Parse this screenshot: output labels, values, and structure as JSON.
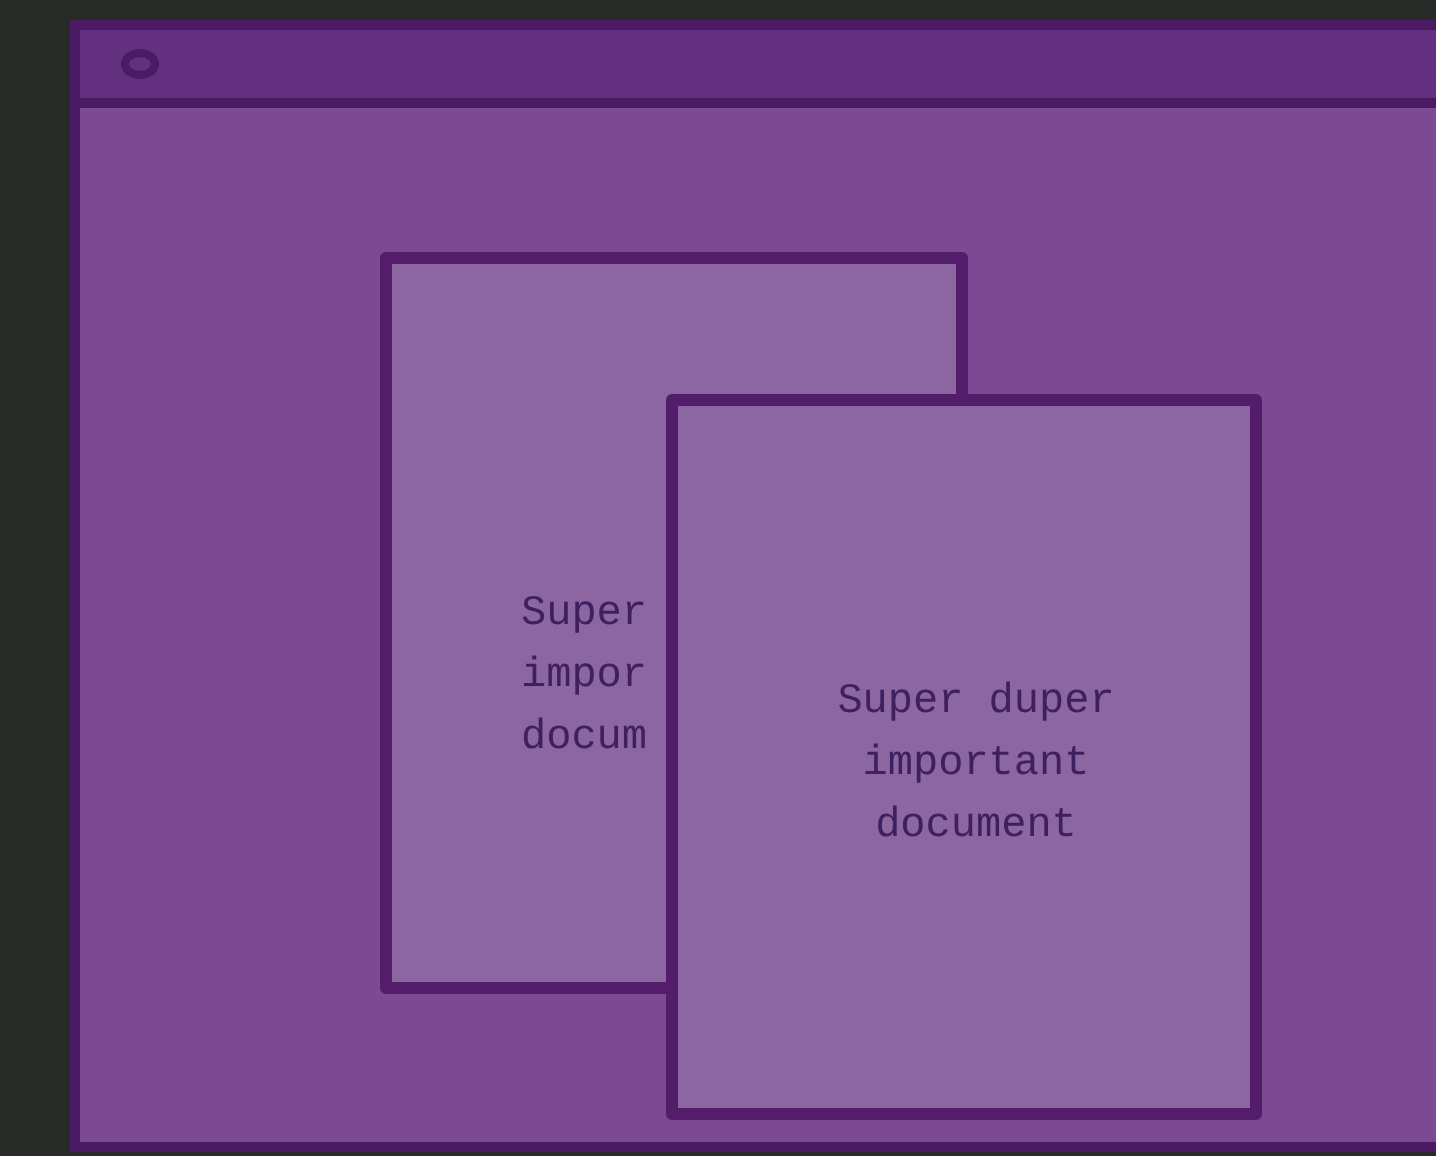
{
  "documents": [
    {
      "lines": [
        "Super",
        "impor",
        "docum"
      ]
    },
    {
      "lines": [
        "Super duper",
        "important",
        "document"
      ]
    }
  ]
}
